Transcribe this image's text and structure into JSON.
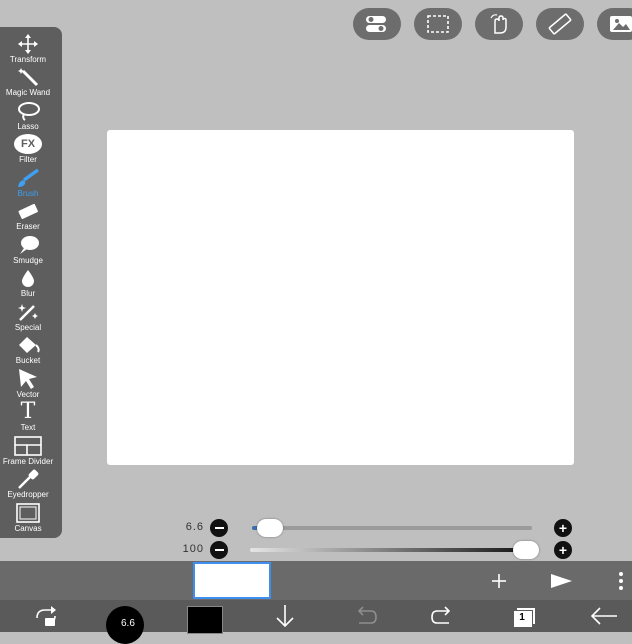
{
  "top_toolbar": {
    "buttons": [
      {
        "icon": "toggle-switch-icon"
      },
      {
        "icon": "selection-icon"
      },
      {
        "icon": "hand-icon"
      },
      {
        "icon": "ruler-icon"
      },
      {
        "icon": "image-icon"
      }
    ]
  },
  "sidebar": {
    "tools": [
      {
        "label": "Transform",
        "icon": "move-arrows-icon"
      },
      {
        "label": "Magic Wand",
        "icon": "magic-wand-icon"
      },
      {
        "label": "Lasso",
        "icon": "lasso-icon"
      },
      {
        "label": "Filter",
        "icon": "fx-icon",
        "icon_text": "FX"
      },
      {
        "label": "Brush",
        "icon": "brush-icon",
        "active": true
      },
      {
        "label": "Eraser",
        "icon": "eraser-icon"
      },
      {
        "label": "Smudge",
        "icon": "smudge-icon"
      },
      {
        "label": "Blur",
        "icon": "drop-icon"
      },
      {
        "label": "Special",
        "icon": "sparkle-brush-icon"
      },
      {
        "label": "Bucket",
        "icon": "bucket-icon"
      },
      {
        "label": "Vector",
        "icon": "cursor-arrow-icon"
      },
      {
        "label": "Text",
        "icon": "text-icon",
        "icon_text": "T"
      },
      {
        "label": "Frame Divider",
        "icon": "frame-divider-icon"
      },
      {
        "label": "Eyedropper",
        "icon": "eyedropper-icon"
      },
      {
        "label": "Canvas",
        "icon": "canvas-icon"
      }
    ],
    "active_color": "#3f9ff0"
  },
  "sliders": {
    "size": {
      "value": "6.6",
      "level": 0.04
    },
    "opacity": {
      "value": "100",
      "level": 1.0
    }
  },
  "layer_bar": {
    "add_icon": "plus-icon",
    "play_icon": "play-icon",
    "more_icon": "more-vertical-icon"
  },
  "bottom_bar": {
    "brush_size_badge": "6.6",
    "primary_color": "#000000",
    "layer_count": "1"
  }
}
